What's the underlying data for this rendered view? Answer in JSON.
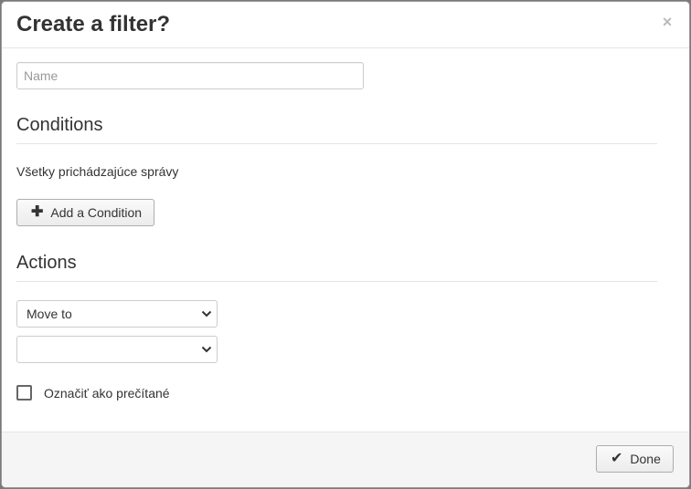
{
  "dialog": {
    "title": "Create a filter?",
    "close_glyph": "×",
    "close_icon": "close-icon"
  },
  "name_field": {
    "placeholder": "Name",
    "value": ""
  },
  "conditions": {
    "title": "Conditions",
    "summary": "Všetky prichádzajúce správy",
    "add_button": {
      "label": "Add a Condition",
      "icon": "plus-icon",
      "glyph": "✚"
    }
  },
  "actions": {
    "title": "Actions",
    "action_select": {
      "value": "Move to"
    },
    "folder_select": {
      "value": ""
    },
    "mark_read": {
      "label": "Označiť ako prečítané",
      "checked": false
    }
  },
  "footer": {
    "done_button": {
      "label": "Done",
      "icon": "checkmark-icon",
      "glyph": "✔"
    }
  }
}
